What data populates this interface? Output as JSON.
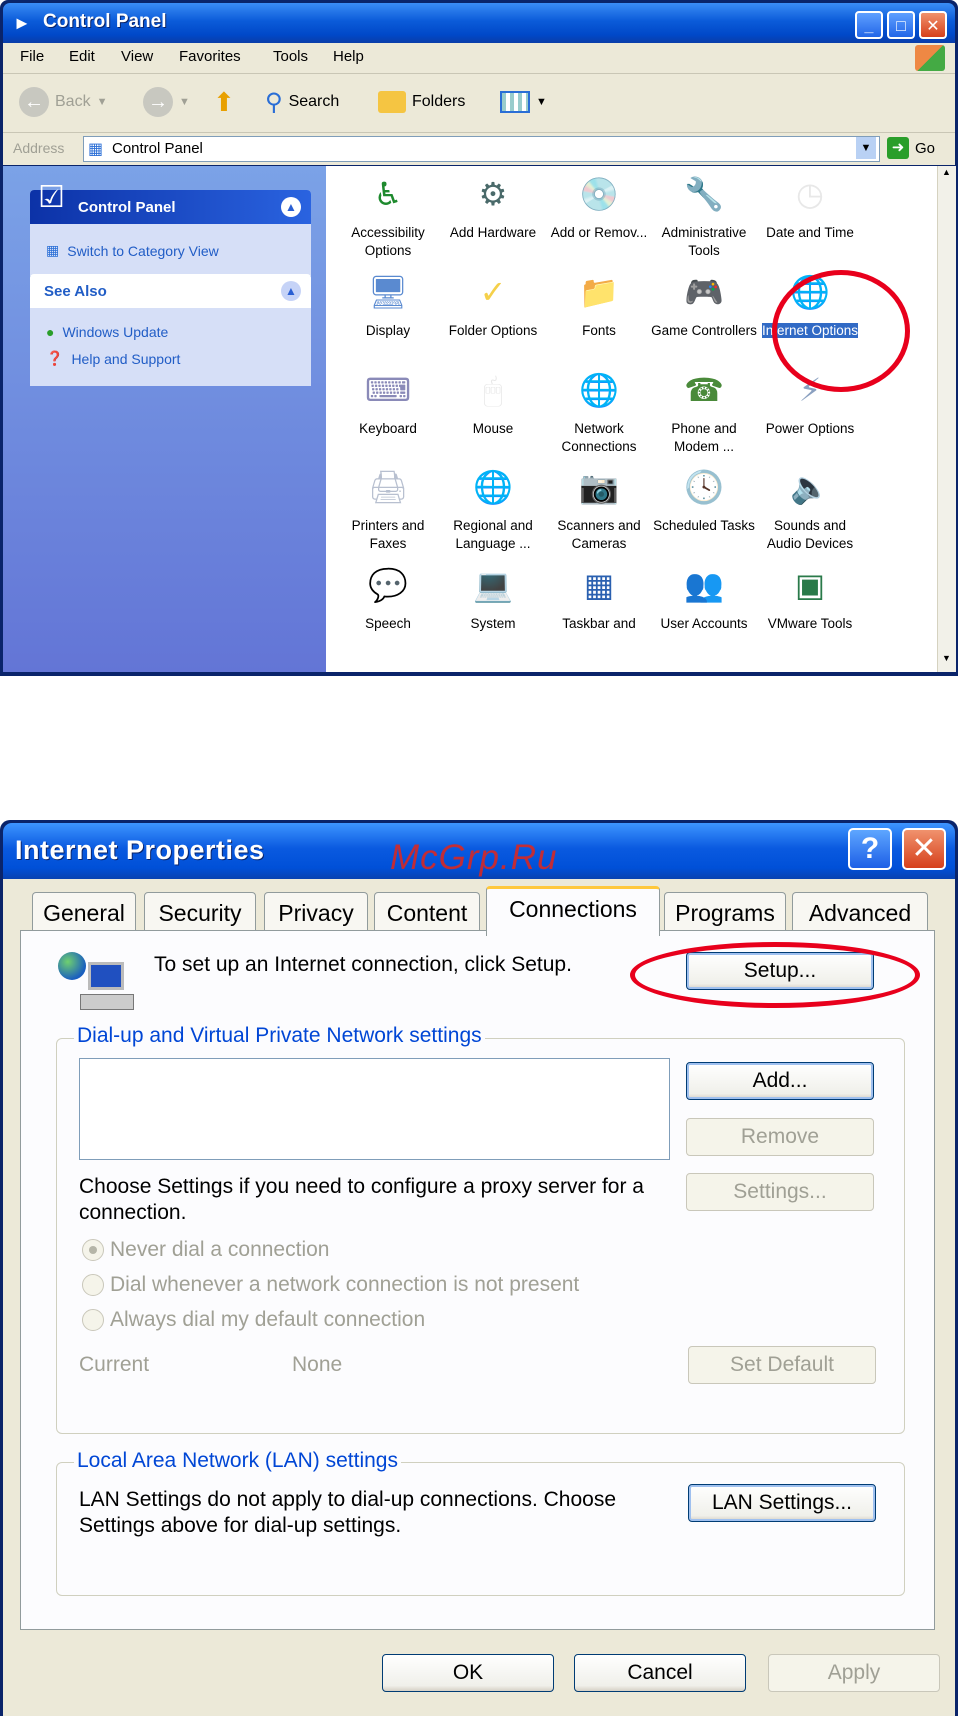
{
  "control_panel": {
    "title": "Control Panel",
    "menu": [
      "File",
      "Edit",
      "View",
      "Favorites",
      "Tools",
      "Help"
    ],
    "toolbar": {
      "back": "Back",
      "search": "Search",
      "folders": "Folders"
    },
    "address_label": "Address",
    "address_value": "Control Panel",
    "go_label": "Go",
    "left_panel": {
      "control_panel_title": "Control Panel",
      "switch_link": "Switch to Category View",
      "see_also_title": "See Also",
      "see_also_links": [
        "Windows Update",
        "Help and Support"
      ]
    },
    "icons": [
      {
        "label": "Accessibility Options",
        "icon": "accessibility-icon"
      },
      {
        "label": "Add Hardware",
        "icon": "hardware-icon"
      },
      {
        "label": "Add or Remov...",
        "icon": "add-remove-icon"
      },
      {
        "label": "Administrative Tools",
        "icon": "admin-tools-icon"
      },
      {
        "label": "Date and Time",
        "icon": "clock-icon"
      },
      {
        "label": "Display",
        "icon": "display-icon"
      },
      {
        "label": "Folder Options",
        "icon": "folder-icon"
      },
      {
        "label": "Fonts",
        "icon": "fonts-folder-icon"
      },
      {
        "label": "Game Controllers",
        "icon": "joystick-icon"
      },
      {
        "label": "Internet Options",
        "icon": "globe-icon",
        "selected": true
      },
      {
        "label": "Keyboard",
        "icon": "keyboard-icon"
      },
      {
        "label": "Mouse",
        "icon": "mouse-icon"
      },
      {
        "label": "Network Connections",
        "icon": "network-icon"
      },
      {
        "label": "Phone and Modem ...",
        "icon": "phone-icon"
      },
      {
        "label": "Power Options",
        "icon": "power-icon"
      },
      {
        "label": "Printers and Faxes",
        "icon": "printer-icon"
      },
      {
        "label": "Regional and Language ...",
        "icon": "globe-icon"
      },
      {
        "label": "Scanners and Cameras",
        "icon": "scanner-icon"
      },
      {
        "label": "Scheduled Tasks",
        "icon": "tasks-folder-icon"
      },
      {
        "label": "Sounds and Audio Devices",
        "icon": "speaker-icon"
      },
      {
        "label": "Speech",
        "icon": "speech-icon"
      },
      {
        "label": "System",
        "icon": "system-icon"
      },
      {
        "label": "Taskbar and",
        "icon": "taskbar-icon"
      },
      {
        "label": "User Accounts",
        "icon": "users-icon"
      },
      {
        "label": "VMware Tools",
        "icon": "vmware-icon"
      }
    ]
  },
  "internet_properties": {
    "title": "Internet Properties",
    "watermark": "McGrp.Ru",
    "tabs": [
      "General",
      "Security",
      "Privacy",
      "Content",
      "Connections",
      "Programs",
      "Advanced"
    ],
    "active_tab": "Connections",
    "setup_text": "To set up an Internet connection, click Setup.",
    "setup_button": "Setup...",
    "dialup_group_title": "Dial-up and Virtual Private Network settings",
    "add_button": "Add...",
    "remove_button": "Remove",
    "settings_button": "Settings...",
    "proxy_text": "Choose Settings if you need to configure a proxy server for a connection.",
    "radios": [
      {
        "label": "Never dial a connection",
        "checked": true
      },
      {
        "label": "Dial whenever a network connection is not present",
        "checked": false
      },
      {
        "label": "Always dial my default connection",
        "checked": false
      }
    ],
    "current_label": "Current",
    "current_value": "None",
    "set_default_button": "Set Default",
    "lan_group_title": "Local Area Network (LAN) settings",
    "lan_text": "LAN Settings do not apply to dial-up connections. Choose Settings above for dial-up settings.",
    "lan_button": "LAN Settings...",
    "ok_button": "OK",
    "cancel_button": "Cancel",
    "apply_button": "Apply"
  }
}
